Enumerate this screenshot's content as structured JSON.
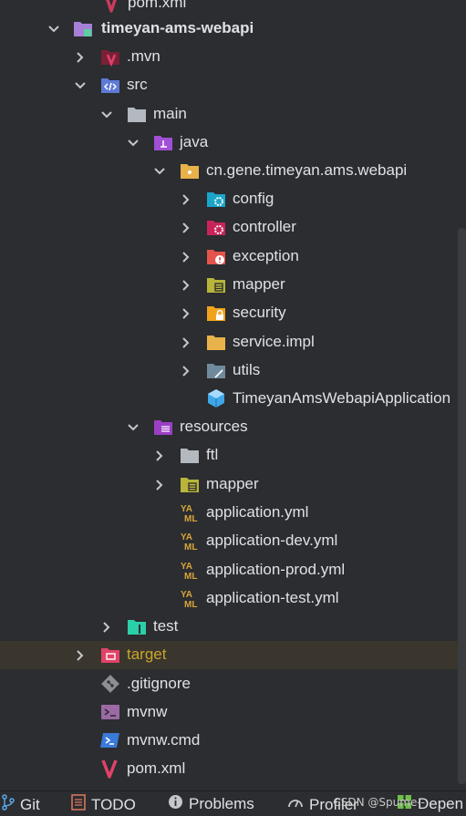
{
  "tree": {
    "top_partial": "pom.xml",
    "module": "timeyan-ams-webapi",
    "mvn": ".mvn",
    "src": "src",
    "main": "main",
    "java": "java",
    "package": "cn.gene.timeyan.ams.webapi",
    "config": "config",
    "controller": "controller",
    "exception": "exception",
    "mapper": "mapper",
    "security": "security",
    "service_impl": "service.impl",
    "utils": "utils",
    "app_class": "TimeyanAmsWebapiApplication",
    "resources": "resources",
    "ftl": "ftl",
    "res_mapper": "mapper",
    "application_yml": "application.yml",
    "application_dev_yml": "application-dev.yml",
    "application_prod_yml": "application-prod.yml",
    "application_test_yml": "application-test.yml",
    "test": "test",
    "target": "target",
    "gitignore": ".gitignore",
    "mvnw": "mvnw",
    "mvnw_cmd": "mvnw.cmd",
    "pom": "pom.xml"
  },
  "statusbar": {
    "git": "Git",
    "todo": "TODO",
    "problems": "Problems",
    "profiler": "Profiler",
    "dependencies": "Depen"
  },
  "watermark": "CSDN @Spume--",
  "colors": {
    "background": "#2b2d30",
    "text": "#dfe1e5",
    "excluded_text": "#c9a52c",
    "selected_row": "#3a362d",
    "folder": "#b4b8bf",
    "package_folder": "#e8b24a",
    "maven_red": "#c93b5b",
    "source_blue": "#5e7ad6",
    "java_purple": "#a14fd6",
    "resources_purple": "#9b3fc4",
    "test_green": "#2ad0a8",
    "config_cyan": "#1ba6c9",
    "exception_red": "#e5534b",
    "mapper_olive": "#b8b53a",
    "yaml_gold": "#d9a53a"
  }
}
